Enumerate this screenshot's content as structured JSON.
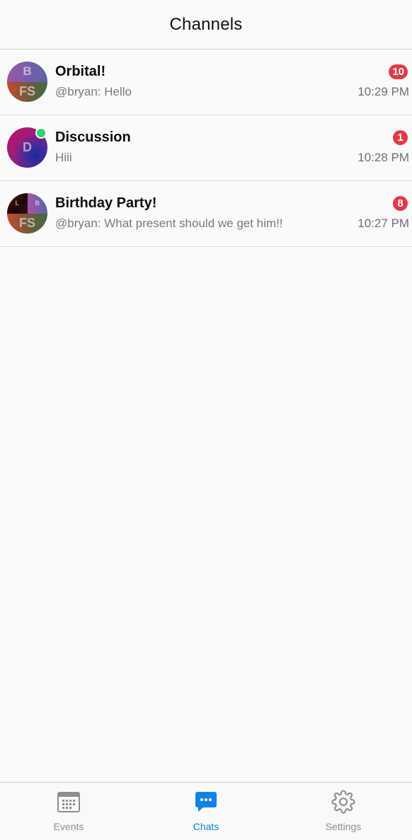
{
  "header": {
    "title": "Channels"
  },
  "channels": [
    {
      "name": "Orbital!",
      "preview": "@bryan: Hello",
      "time": "10:29 PM",
      "unread": "10",
      "avatar": {
        "top_initial": "B",
        "bottom_initial": "FS"
      }
    },
    {
      "name": "Discussion",
      "preview": "Hiii",
      "time": "10:28 PM",
      "unread": "1",
      "online": true,
      "avatar": {
        "initial": "D"
      }
    },
    {
      "name": "Birthday Party!",
      "preview": "@bryan: What present should we get him!!",
      "time": "10:27 PM",
      "unread": "8",
      "avatar": {
        "top_left_initial": "L",
        "top_right_initial": "B",
        "bottom_initial": "FS"
      }
    }
  ],
  "tabs": [
    {
      "label": "Events",
      "icon": "calendar-icon",
      "active": false
    },
    {
      "label": "Chats",
      "icon": "chat-bubble-icon",
      "active": true
    },
    {
      "label": "Settings",
      "icon": "gear-icon",
      "active": false
    }
  ],
  "colors": {
    "accent": "#1283e4",
    "badge": "#e43a48",
    "online": "#2bd46a",
    "inactive_tab": "#8e8e8e"
  }
}
